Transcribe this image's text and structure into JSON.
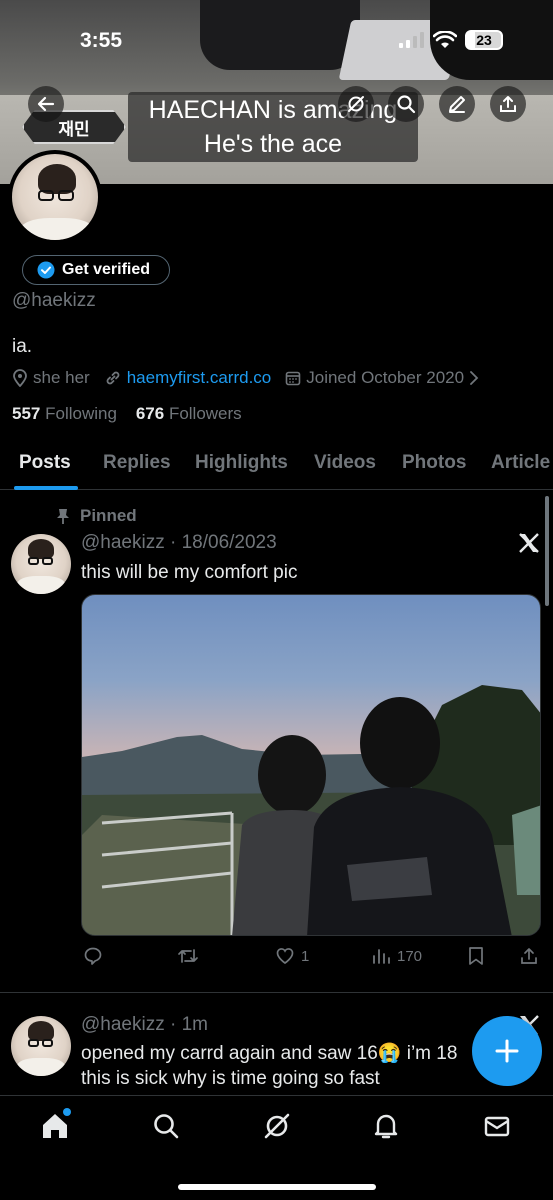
{
  "status_bar": {
    "time": "3:55",
    "battery": "23"
  },
  "banner": {
    "caption_line1": "HAECHAN is amazing",
    "caption_line2": "He's the ace",
    "name_card": "재민"
  },
  "profile": {
    "verify_label": "Get verified",
    "handle": "@haekizz",
    "bio": "ia.",
    "pronouns": "she her",
    "website": "haemyfirst.carrd.co",
    "joined": "Joined October 2020",
    "following_count": "557",
    "following_label": "Following",
    "followers_count": "676",
    "followers_label": "Followers"
  },
  "tabs": [
    "Posts",
    "Replies",
    "Highlights",
    "Videos",
    "Photos",
    "Article"
  ],
  "posts": [
    {
      "pinned_label": "Pinned",
      "header": "@haekizz · 18/06/2023",
      "text": "this will be my comfort pic",
      "likes": "1",
      "views": "170"
    },
    {
      "header": "@haekizz · 1m",
      "text_line1": "opened my carrd again and saw 16😭  i’m 18",
      "text_line2": "this is sick why is time going so fast"
    }
  ],
  "colors": {
    "accent": "#1d9bf0",
    "muted": "#71767b",
    "text": "#e7e9ea",
    "bg": "#000000"
  }
}
